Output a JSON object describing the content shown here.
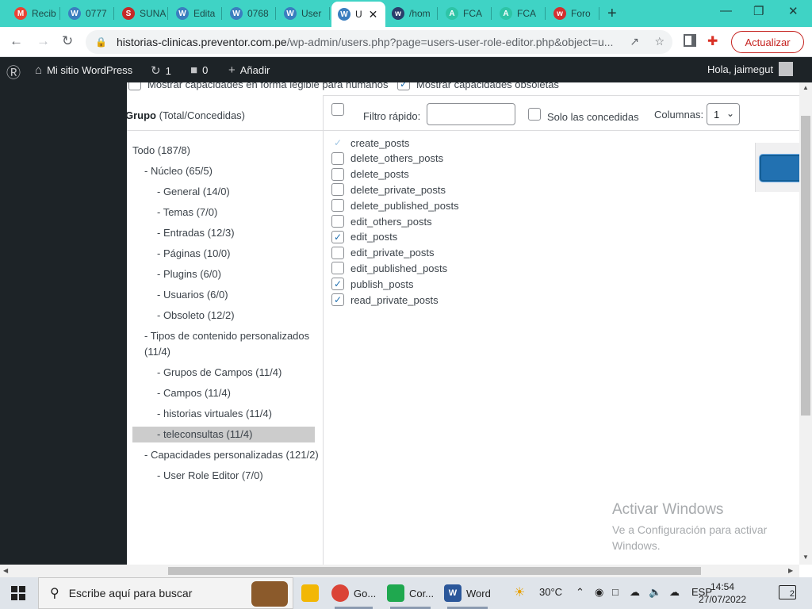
{
  "browser": {
    "tabs": [
      {
        "label": "Recib",
        "icon": "gmail-icon",
        "color": "#ea4335"
      },
      {
        "label": "0777",
        "icon": "wordpress-icon",
        "color": "#3a7ebf"
      },
      {
        "label": "SUNA",
        "icon": "sunat-icon",
        "color": "#c62828"
      },
      {
        "label": "Edita",
        "icon": "wordpress-icon",
        "color": "#3a7ebf"
      },
      {
        "label": "0768",
        "icon": "wordpress-icon",
        "color": "#3a7ebf"
      },
      {
        "label": "User",
        "icon": "wordpress-icon",
        "color": "#3a7ebf"
      },
      {
        "label": "U",
        "icon": "wordpress-icon",
        "color": "#3a7ebf"
      },
      {
        "label": "/hom",
        "icon": "webmin-icon",
        "color": "#2a3d6b"
      },
      {
        "label": "FCA",
        "icon": "fca-icon",
        "color": "#2ec4a6"
      },
      {
        "label": "FCA",
        "icon": "fca-icon",
        "color": "#2ec4a6"
      },
      {
        "label": "Foro",
        "icon": "foro-icon",
        "color": "#d32f2f"
      }
    ],
    "url_host": "historias-clinicas.preventor.com.pe",
    "url_path": "/wp-admin/users.php?page=users-user-role-editor.php&object=u...",
    "update_label": "Actualizar",
    "accent": "#3fd3c5"
  },
  "adminbar": {
    "site_name": "Mi sitio WordPress",
    "updates_count": "1",
    "comments_count": "0",
    "add_new": "Añadir",
    "greeting": "Hola, jaimegut"
  },
  "options": {
    "human_readable": "Mostrar capacidades en forma legible para humanos",
    "show_deprecated": "Mostrar capacidades obsoletas"
  },
  "group_header": {
    "bold": "Grupo",
    "rest": " (Total/Concedidas)"
  },
  "filter": {
    "quick_filter_label": "Filtro rápido:",
    "quick_filter_value": "",
    "granted_only_label": "Solo las concedidas",
    "columns_label": "Columnas:",
    "columns_value": "1"
  },
  "groups": [
    {
      "label": "Todo (187/8)",
      "depth": 0
    },
    {
      "label": "- Núcleo (65/5)",
      "depth": 1
    },
    {
      "label": "- General (14/0)",
      "depth": 2
    },
    {
      "label": "- Temas (7/0)",
      "depth": 2
    },
    {
      "label": "- Entradas (12/3)",
      "depth": 2
    },
    {
      "label": "- Páginas (10/0)",
      "depth": 2
    },
    {
      "label": "- Plugins (6/0)",
      "depth": 2
    },
    {
      "label": "- Usuarios (6/0)",
      "depth": 2
    },
    {
      "label": "- Obsoleto (12/2)",
      "depth": 2
    },
    {
      "label": "- Tipos de contenido personalizados",
      "label2": "(11/4)",
      "depth": 1
    },
    {
      "label": "- Grupos de Campos (11/4)",
      "depth": 2
    },
    {
      "label": "- Campos (11/4)",
      "depth": 2
    },
    {
      "label": "- historias virtuales (11/4)",
      "depth": 2
    },
    {
      "label": "- teleconsultas (11/4)",
      "depth": 2,
      "selected": true
    },
    {
      "label": "- Capacidades personalizadas (121/2)",
      "depth": 1
    },
    {
      "label": "- User Role Editor (7/0)",
      "depth": 2
    }
  ],
  "capabilities": [
    {
      "name": "create_posts",
      "checked": true,
      "disabled": true
    },
    {
      "name": "delete_others_posts",
      "checked": false
    },
    {
      "name": "delete_posts",
      "checked": false
    },
    {
      "name": "delete_private_posts",
      "checked": false
    },
    {
      "name": "delete_published_posts",
      "checked": false
    },
    {
      "name": "edit_others_posts",
      "checked": false
    },
    {
      "name": "edit_posts",
      "checked": true
    },
    {
      "name": "edit_private_posts",
      "checked": false
    },
    {
      "name": "edit_published_posts",
      "checked": false
    },
    {
      "name": "publish_posts",
      "checked": true
    },
    {
      "name": "read_private_posts",
      "checked": true
    }
  ],
  "watermark": {
    "title": "Activar Windows",
    "line": "Ve a Configuración para activar Windows."
  },
  "taskbar": {
    "search_placeholder": "Escribe aquí para buscar",
    "apps": [
      {
        "label": "",
        "icon": "file-explorer-icon",
        "color": "#f2b705"
      },
      {
        "label": "Go...",
        "icon": "chrome-icon",
        "color": "#db4437"
      },
      {
        "label": "Cor...",
        "icon": "corel-icon",
        "color": "#1fa84f"
      },
      {
        "label": "Word",
        "icon": "word-icon",
        "color": "#2b579a"
      }
    ],
    "weather": "30°C",
    "language": "ESP",
    "time": "14:54",
    "date": "27/07/2022",
    "notifications": "2"
  }
}
